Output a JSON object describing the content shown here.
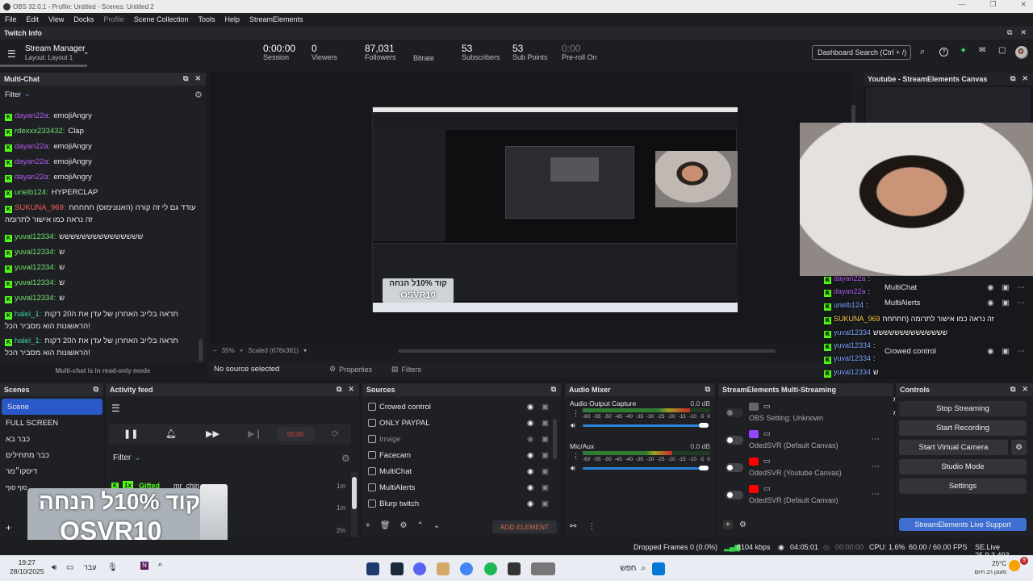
{
  "window": {
    "title": "OBS 32.0.1 - Profile: Untitled - Scenes: Untitled 2"
  },
  "menu": [
    "File",
    "Edit",
    "View",
    "Docks",
    "Profile",
    "Scene Collection",
    "Tools",
    "Help",
    "StreamElements"
  ],
  "twitch_info": {
    "title": "Twitch Info",
    "stream_manager": "Stream Manager",
    "layout": "Layout: Layout 1",
    "stats": [
      {
        "value": "0:00:00",
        "label": "Session"
      },
      {
        "value": "0",
        "label": "Viewers"
      },
      {
        "value": "87,031",
        "label": "Followers"
      },
      {
        "value": "",
        "label": "Bitrate"
      },
      {
        "value": "53",
        "label": "Subscribers"
      },
      {
        "value": "53",
        "label": "Sub Points"
      },
      {
        "value": "0:00",
        "label": "Pre-roll On"
      }
    ],
    "search_placeholder": "Dashboard Search (Ctrl + /)"
  },
  "multichat": {
    "title": "Multi-Chat",
    "filter": "Filter",
    "readonly_note": "Multi-chat is in read-only mode",
    "messages": [
      {
        "user": "dayan22a:",
        "text": "emojiAngry",
        "color": "#b45cf2"
      },
      {
        "user": "rdexxx233432:",
        "text": "Clap",
        "color": "#6ee06e"
      },
      {
        "user": "dayan22a:",
        "text": "emojiAngry",
        "color": "#b45cf2"
      },
      {
        "user": "dayan22a:",
        "text": "emojiAngry",
        "color": "#b45cf2"
      },
      {
        "user": "dayan22a:",
        "text": "emojiAngry",
        "color": "#b45cf2"
      },
      {
        "user": "urielb124:",
        "text": "HYPERCLAP",
        "color": "#6ee06e"
      },
      {
        "user": "SUKUNA_969:",
        "text": "עודד גם לי זה קורה (האנונימוס) חחחחח",
        "text2": "זה נראה כמו אישור לתרומה",
        "color": "#ff5a5a"
      },
      {
        "user": "yuval12334:",
        "text": "ששששששששששששששש",
        "color": "#6ee06e"
      },
      {
        "user": "yuval12334:",
        "text": "ש",
        "color": "#6ee06e"
      },
      {
        "user": "yuval12334:",
        "text": "ש",
        "color": "#6ee06e"
      },
      {
        "user": "yuval12334:",
        "text": "ש",
        "color": "#6ee06e"
      },
      {
        "user": "yuval12334:",
        "text": "ש",
        "color": "#6ee06e"
      },
      {
        "user": "halel_1:",
        "text": "תראה בלייב האחרון של עדן את ה20 דקות",
        "text2": "הראשונות הוא מסביר הכל!",
        "color": "#3ad0a7"
      },
      {
        "user": "halel_1:",
        "text": "תראה בלייב האחרון של עדן את ה20 דקות",
        "text2": "הראשונות הוא מסביר הכל!",
        "color": "#3ad0a7"
      }
    ]
  },
  "preview": {
    "zoom": "35%",
    "scaled": "Scaled (678x381)",
    "no_source": "No source selected",
    "properties": "Properties",
    "filters": "Filters",
    "overlay_promo_line1": "קוד 10%ל הנחה",
    "overlay_promo_line2": "OSVR10"
  },
  "youtube_canvas": {
    "title": "Youtube - StreamElements Canvas",
    "sources": [
      "MultiChat",
      "MultiAlerts",
      "Crowed control"
    ],
    "chat": [
      {
        "user": "dayan22a",
        "text": ":"
      },
      {
        "user": "dayan22a",
        "text": ":"
      },
      {
        "user": "urielb124",
        "text": ":"
      },
      {
        "user": "SUKUNA_969",
        "text": "זה נראה כמו אישור לתרומה (חחחחח"
      },
      {
        "user": "yuval12334",
        "text": "שששששששששששששש"
      },
      {
        "user": "yuval12334",
        "text": ":"
      },
      {
        "user": "yuval12334",
        "text": ":"
      },
      {
        "user": "yuval12334",
        "text": "ש"
      },
      {
        "user": "halel_1",
        "text": "הראשונות הוא מסביר הכל ה20 דקות"
      },
      {
        "user": "halel_1",
        "text": "הראשונות הוא מסביר הכל ה20 דקות"
      }
    ],
    "stop_streaming": "Stop Streaming"
  },
  "scenes": {
    "title": "Scenes",
    "items": [
      "Scene",
      "FULL SCREEN",
      "כבר בא",
      "כבר מתחילים",
      "דיסקו״מר",
      "סוף סוף"
    ]
  },
  "activity_feed": {
    "title": "Activity feed",
    "filter": "Filter",
    "timer": "00:00",
    "items": [
      {
        "badge": "1x",
        "label": "Gifted",
        "user": "mr_chin...",
        "time": "1m"
      },
      {
        "time": "1m"
      },
      {
        "time": "2m"
      }
    ],
    "promo_line1": "קוד 10%ל הנחה",
    "promo_line2": "OSVR10"
  },
  "sources": {
    "title": "Sources",
    "items": [
      "Crowed control",
      "ONLY PAYPAL",
      "Image",
      "Facecam",
      "MultiChat",
      "MultiAlerts",
      "Blurp twitch"
    ],
    "add_element": "ADD ELEMENT"
  },
  "audio_mixer": {
    "title": "Audio Mixer",
    "channels": [
      {
        "name": "Audio Output Capture",
        "db": "0.0 dB",
        "level": 0.84,
        "volume": 1.0
      },
      {
        "name": "Mic/Aux",
        "db": "0.0 dB",
        "level": 0.7,
        "volume": 1.0
      }
    ],
    "scale": [
      "-60",
      "-55",
      "-50",
      "-45",
      "-40",
      "-35",
      "-30",
      "-25",
      "-20",
      "-15",
      "-10",
      "-5",
      "0"
    ]
  },
  "multistreaming": {
    "title": "StreamElements Multi-Streaming",
    "outputs": [
      {
        "name": "OBS Setting: Unknown"
      },
      {
        "name": "OdedSVR (Default Canvas)"
      },
      {
        "name": "OdedSVR (Youtube Canvas)"
      },
      {
        "name": "OdedSVR (Default Canvas)"
      }
    ]
  },
  "controls": {
    "title": "Controls",
    "buttons": [
      "Start Recording",
      "Start Virtual Camera",
      "Studio Mode",
      "Settings"
    ],
    "support": "StreamElements Live Support"
  },
  "status": {
    "dropped": "Dropped Frames 0 (0.0%)",
    "kbps": "8104 kbps",
    "live_time": "04:05:01",
    "rec_time": "00:00:00",
    "cpu": "CPU: 1.6%",
    "fps": "60.00 / 60.00 FPS",
    "version": "SE.Live 25.9.3.493"
  },
  "taskbar": {
    "time": "19:27",
    "date": "28/10/2025",
    "lang": "עבר",
    "search": "חפש",
    "temp": "25°C",
    "weather": "מעונן רב היום",
    "notif_count": "9"
  }
}
